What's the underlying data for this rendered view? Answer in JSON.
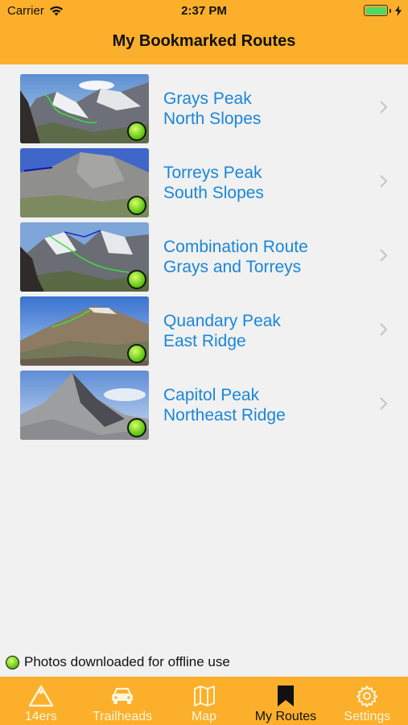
{
  "status_bar": {
    "carrier": "Carrier",
    "time": "2:37 PM",
    "wifi_icon": "wifi-icon",
    "battery_icon": "battery-icon",
    "charging_icon": "bolt-icon"
  },
  "nav": {
    "title": "My Bookmarked Routes"
  },
  "routes": [
    {
      "line1": "Grays Peak",
      "line2": "North Slopes",
      "downloaded": true
    },
    {
      "line1": "Torreys Peak",
      "line2": "South Slopes",
      "downloaded": true
    },
    {
      "line1": "Combination Route",
      "line2": "Grays and Torreys",
      "downloaded": true
    },
    {
      "line1": "Quandary Peak",
      "line2": "East Ridge",
      "downloaded": true
    },
    {
      "line1": "Capitol Peak",
      "line2": "Northeast Ridge",
      "downloaded": true
    }
  ],
  "legend": {
    "text": "Photos downloaded for offline use"
  },
  "tabs": [
    {
      "label": "14ers",
      "icon": "mountain-icon",
      "active": false
    },
    {
      "label": "Trailheads",
      "icon": "car-icon",
      "active": false
    },
    {
      "label": "Map",
      "icon": "map-icon",
      "active": false
    },
    {
      "label": "My Routes",
      "icon": "bookmark-icon",
      "active": true
    },
    {
      "label": "Settings",
      "icon": "gear-icon",
      "active": false
    }
  ],
  "colors": {
    "brand_orange": "#fbaf2a",
    "link_blue": "#1a86d8",
    "offline_green": "#57c10d"
  }
}
